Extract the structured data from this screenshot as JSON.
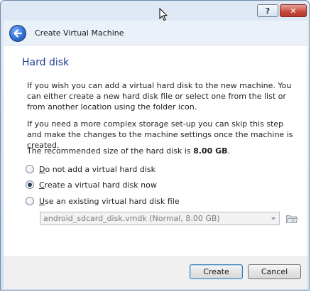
{
  "window": {
    "help_label": "?",
    "close_label": "✕"
  },
  "header": {
    "title": "Create Virtual Machine"
  },
  "page": {
    "title": "Hard disk",
    "paragraph1": "If you wish you can add a virtual hard disk to the new machine. You can either create a new hard disk file or select one from the list or from another location using the folder icon.",
    "paragraph2": "If you need a more complex storage set-up you can skip this step and make the changes to the machine settings once the machine is created.",
    "recommended_prefix": "The recommended size of the hard disk is ",
    "recommended_size": "8.00 GB",
    "recommended_suffix": "."
  },
  "options": {
    "no_disk": {
      "prefix": "",
      "mnemonic": "D",
      "rest": "o not add a virtual hard disk",
      "checked": false
    },
    "create_disk": {
      "prefix": "",
      "mnemonic": "C",
      "rest": "reate a virtual hard disk now",
      "checked": true
    },
    "existing_disk": {
      "prefix": "",
      "mnemonic": "U",
      "rest": "se an existing virtual hard disk file",
      "checked": false
    }
  },
  "existing_disk_combo": {
    "selected": "android_sdcard_disk.vmdk (Normal, 8.00 GB)"
  },
  "icons": {
    "back": "back-arrow-icon",
    "folder": "folder-open-icon"
  },
  "footer": {
    "create_label": "Create",
    "cancel_label": "Cancel"
  }
}
